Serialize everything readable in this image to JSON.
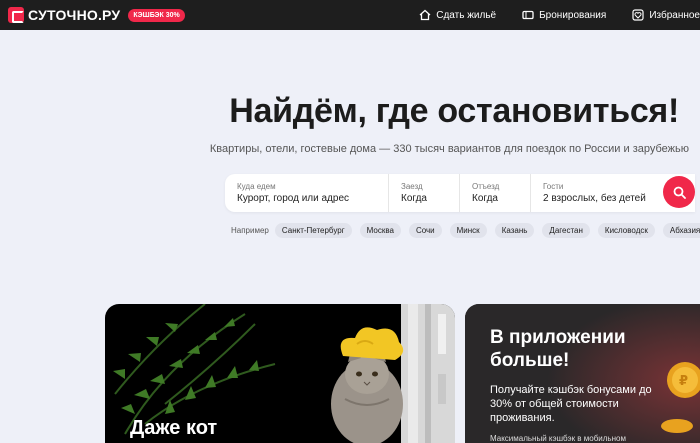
{
  "header": {
    "logo_text": "СУТОЧНО.РУ",
    "cashback_badge": "КЭШБЭК 30%",
    "nav": [
      {
        "label": "Сдать жильё",
        "icon": "house-icon"
      },
      {
        "label": "Бронирования",
        "icon": "ticket-icon"
      },
      {
        "label": "Избранное",
        "icon": "heart-icon"
      }
    ]
  },
  "hero": {
    "title": "Найдём, где остановиться!",
    "subtitle": "Квартиры, отели, гостевые дома — 330 тысяч вариантов для поездок по России и зарубежью"
  },
  "search": {
    "where_label": "Куда едем",
    "where_value": "Курорт, город или адрес",
    "checkin_label": "Заезд",
    "checkin_value": "Когда",
    "checkout_label": "Отъезд",
    "checkout_value": "Когда",
    "guests_label": "Гости",
    "guests_value": "2 взрослых, без детей"
  },
  "examples": {
    "label": "Например",
    "chips": [
      "Санкт-Петербург",
      "Москва",
      "Сочи",
      "Минск",
      "Казань",
      "Дагестан",
      "Кисловодск",
      "Абхазия"
    ]
  },
  "cards": {
    "cat_title": "Даже кот",
    "app_title": "В приложении больше!",
    "app_text": "Получайте кэшбэк бонусами до 30% от общей стоимости проживания.",
    "app_note": "Максимальный кэшбэк в мобильном"
  },
  "colors": {
    "brand": "#f0284a",
    "header_bg": "#1e1e1e",
    "page_bg": "#eef0f8"
  }
}
